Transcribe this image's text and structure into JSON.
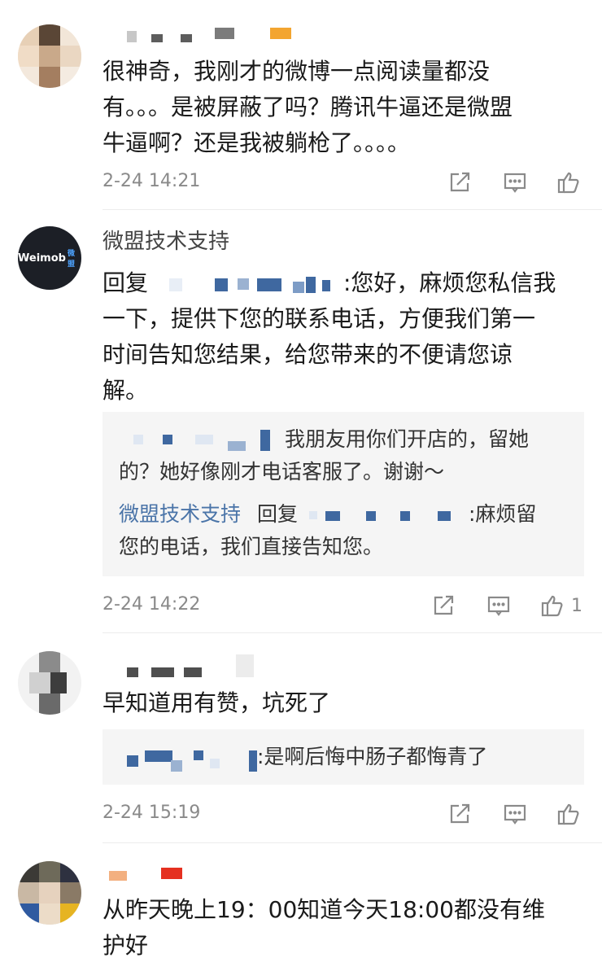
{
  "comments": [
    {
      "content": "很神奇，我刚才的微博一点阅读量都没\n有。。。是被屏蔽了吗？腾讯牛逼还是微盟\n牛逼啊？还是我被躺枪了。。。。",
      "time": "2-24 14:21"
    },
    {
      "avatar_text": "Weimob",
      "avatar_sub": "微盟",
      "username": "微盟技术支持",
      "reply_prefix": "回复",
      "content_suffix": ":您好，麻烦您私信我\n一下，提供下您的联系电话，方便我们第一\n时间告知您结果，给您带来的不便请您谅\n解。",
      "sub_replies": [
        {
          "text": "我朋友用你们开店的，留她\n的？她好像刚才电话客服了。谢谢～"
        },
        {
          "author": "微盟技术支持",
          "prefix": "回复",
          "text": ":麻烦留\n您的电话，我们直接告知您。"
        }
      ],
      "time": "2-24 14:22",
      "like_count": "1"
    },
    {
      "content": "早知道用有赞，坑死了",
      "sub_replies": [
        {
          "text": ":是啊后悔中肠子都悔青了"
        }
      ],
      "time": "2-24 15:19"
    },
    {
      "content": "从昨天晚上19：00知道今天18:00都没有维\n护好"
    }
  ],
  "icons": {
    "share": "share-icon",
    "comment": "comment-icon",
    "like": "thumbs-up-icon"
  },
  "colors": {
    "link_blue": "#4a74a8",
    "meta_gray": "#8a8a8a",
    "reply_bg": "#f5f5f5"
  }
}
